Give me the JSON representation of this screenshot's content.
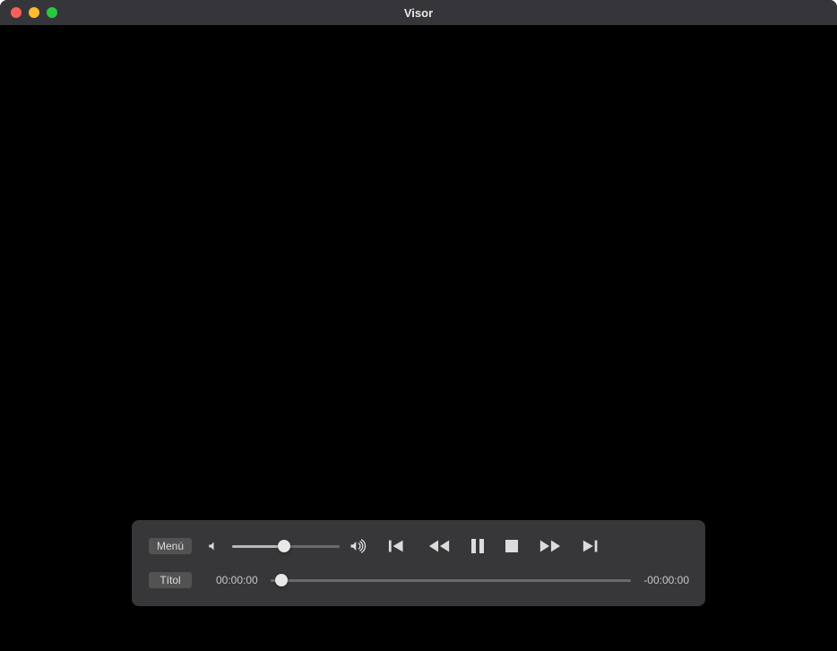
{
  "window": {
    "title": "Visor"
  },
  "controller": {
    "menu_button_label": "Menú",
    "title_button_label": "Títol",
    "time_elapsed": "00:00:00",
    "time_remaining": "-00:00:00",
    "volume_percent": 48,
    "progress_percent": 3,
    "icons": {
      "volume_low": "volume-low-icon",
      "volume_high": "volume-high-icon",
      "skip_back": "skip-back-icon",
      "rewind": "rewind-icon",
      "pause": "pause-icon",
      "stop": "stop-icon",
      "fast_forward": "fast-forward-icon",
      "skip_forward": "skip-forward-icon"
    }
  }
}
